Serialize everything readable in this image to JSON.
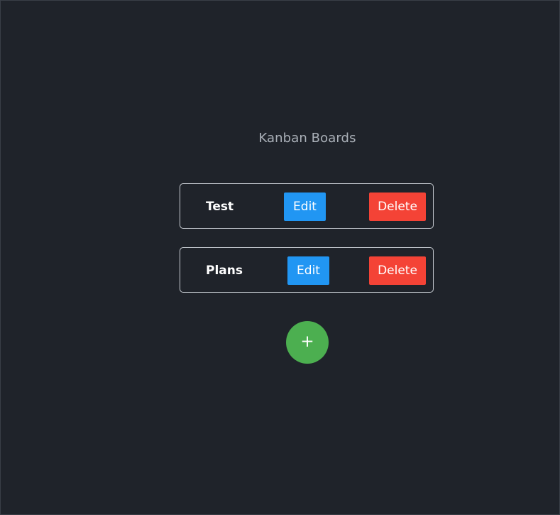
{
  "page": {
    "title": "Kanban Boards"
  },
  "boards": [
    {
      "name": "Test",
      "edit_label": "Edit",
      "delete_label": "Delete"
    },
    {
      "name": "Plans",
      "edit_label": "Edit",
      "delete_label": "Delete"
    }
  ],
  "actions": {
    "add_label": "+"
  },
  "colors": {
    "background": "#1f232a",
    "title_text": "#aab0b8",
    "edit_button": "#2196f3",
    "delete_button": "#f44336",
    "add_button": "#4caf50",
    "row_border": "#c7ccd2"
  }
}
